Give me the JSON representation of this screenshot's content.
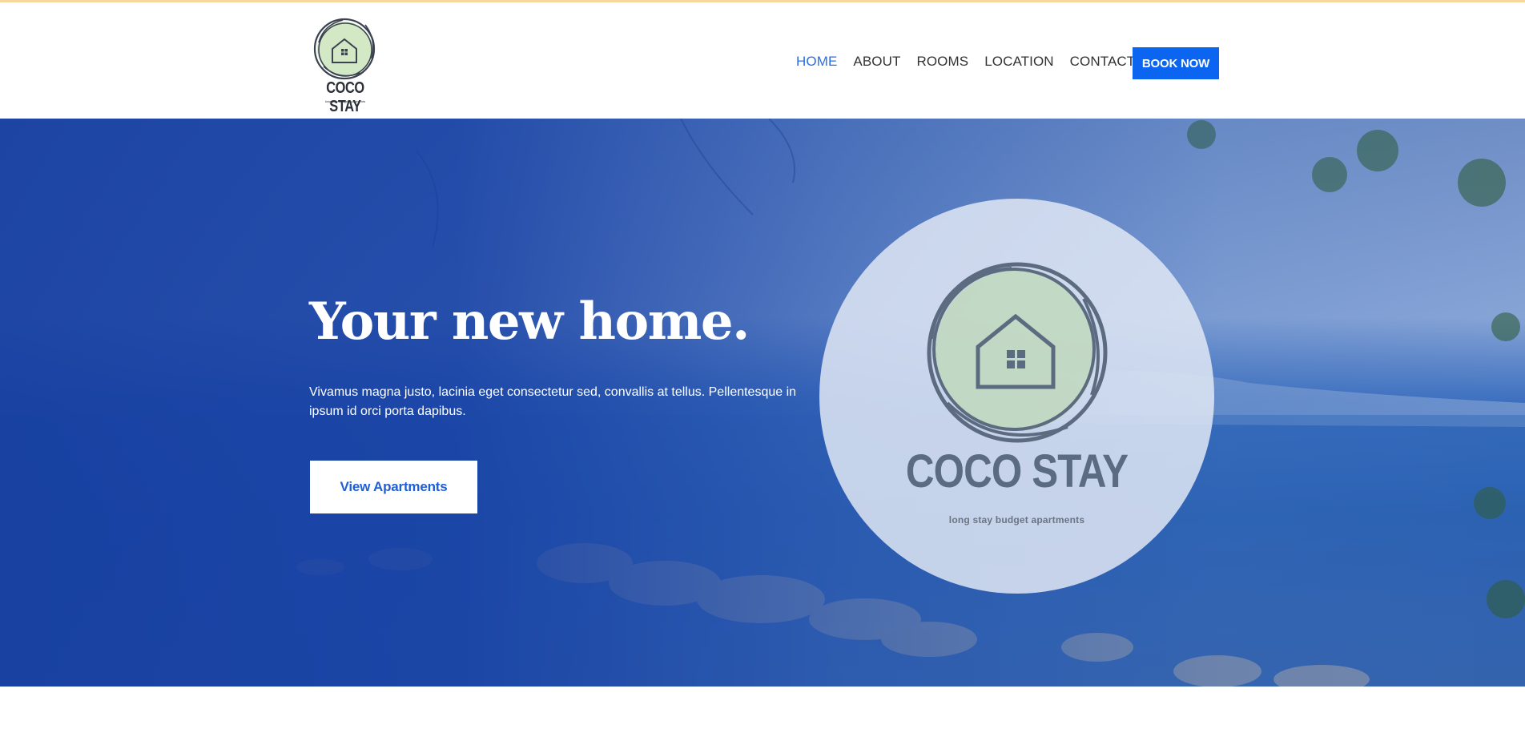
{
  "header": {
    "logo": {
      "title": "COCO STAY",
      "subtitle": "long stay budget apartments"
    },
    "nav": [
      {
        "label": "HOME",
        "active": true
      },
      {
        "label": "ABOUT",
        "active": false
      },
      {
        "label": "ROOMS",
        "active": false
      },
      {
        "label": "LOCATION",
        "active": false
      },
      {
        "label": "CONTACT",
        "active": false
      }
    ],
    "book_button": "BOOK NOW"
  },
  "hero": {
    "title": "Your new home.",
    "text": "Vivamus magna justo, lacinia eget consectetur sed, convallis at tellus. Pellentesque in ipsum id orci porta dapibus.",
    "button": "View Apartments",
    "badge": {
      "title": "COCO STAY",
      "subtitle": "long stay budget apartments"
    }
  },
  "colors": {
    "accent": "#0c65f0",
    "nav_active": "#2a6ee8",
    "hero_overlay": "#1a44a4",
    "top_line": "#f5d89a"
  },
  "icons": [
    "house-wreath-logo-icon"
  ]
}
